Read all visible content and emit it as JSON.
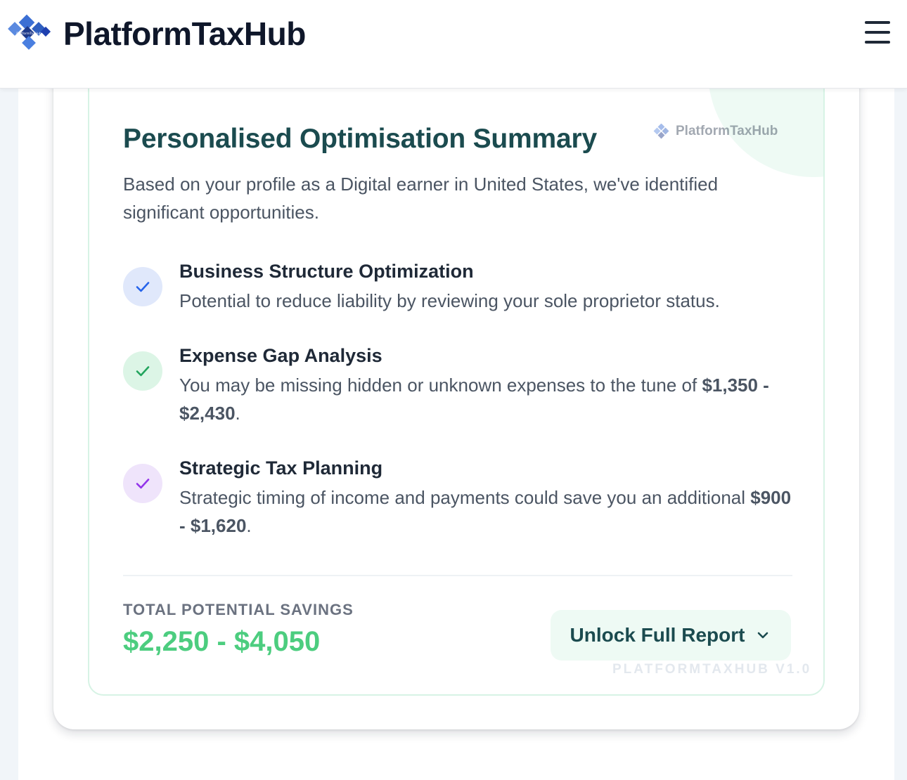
{
  "header": {
    "brand_name": "PlatformTaxHub",
    "logo_text": "PlatformTaxHub"
  },
  "summary": {
    "title": "Personalised Optimisation Summary",
    "watermark_brand": "PlatformTaxHub",
    "intro": "Based on your profile as a Digital earner in United States, we've identified significant opportunities.",
    "features": [
      {
        "title": "Business Structure Optimization",
        "description": "Potential to reduce liability by reviewing your sole proprietor status.",
        "icon": "check-icon",
        "badge_color": "#e0e8fb",
        "check_color": "#2563eb"
      },
      {
        "title": "Expense Gap Analysis",
        "description_prefix": "You may be missing hidden or unknown expenses to the tune of",
        "amount": "$1,350 - $2,430",
        "description_suffix": ".",
        "icon": "check-icon",
        "badge_color": "#dcf5e6",
        "check_color": "#22a45d"
      },
      {
        "title": "Strategic Tax Planning",
        "description_prefix": "Strategic timing of income and payments could save you an additional",
        "amount": "$900 - $1,620",
        "description_suffix": ".",
        "icon": "check-icon",
        "badge_color": "#efe4fb",
        "check_color": "#9333ea"
      }
    ],
    "savings_label": "TOTAL POTENTIAL SAVINGS",
    "savings_value": "$2,250 - $4,050",
    "unlock_button_label": "Unlock Full Report",
    "version_stamp": "PLATFORMTAXHUB V1.0"
  },
  "colors": {
    "title": "#1b4b4f",
    "savings_value": "#4ccd7f",
    "card_border": "#d7f3e5",
    "button_background": "#eefaf4"
  }
}
